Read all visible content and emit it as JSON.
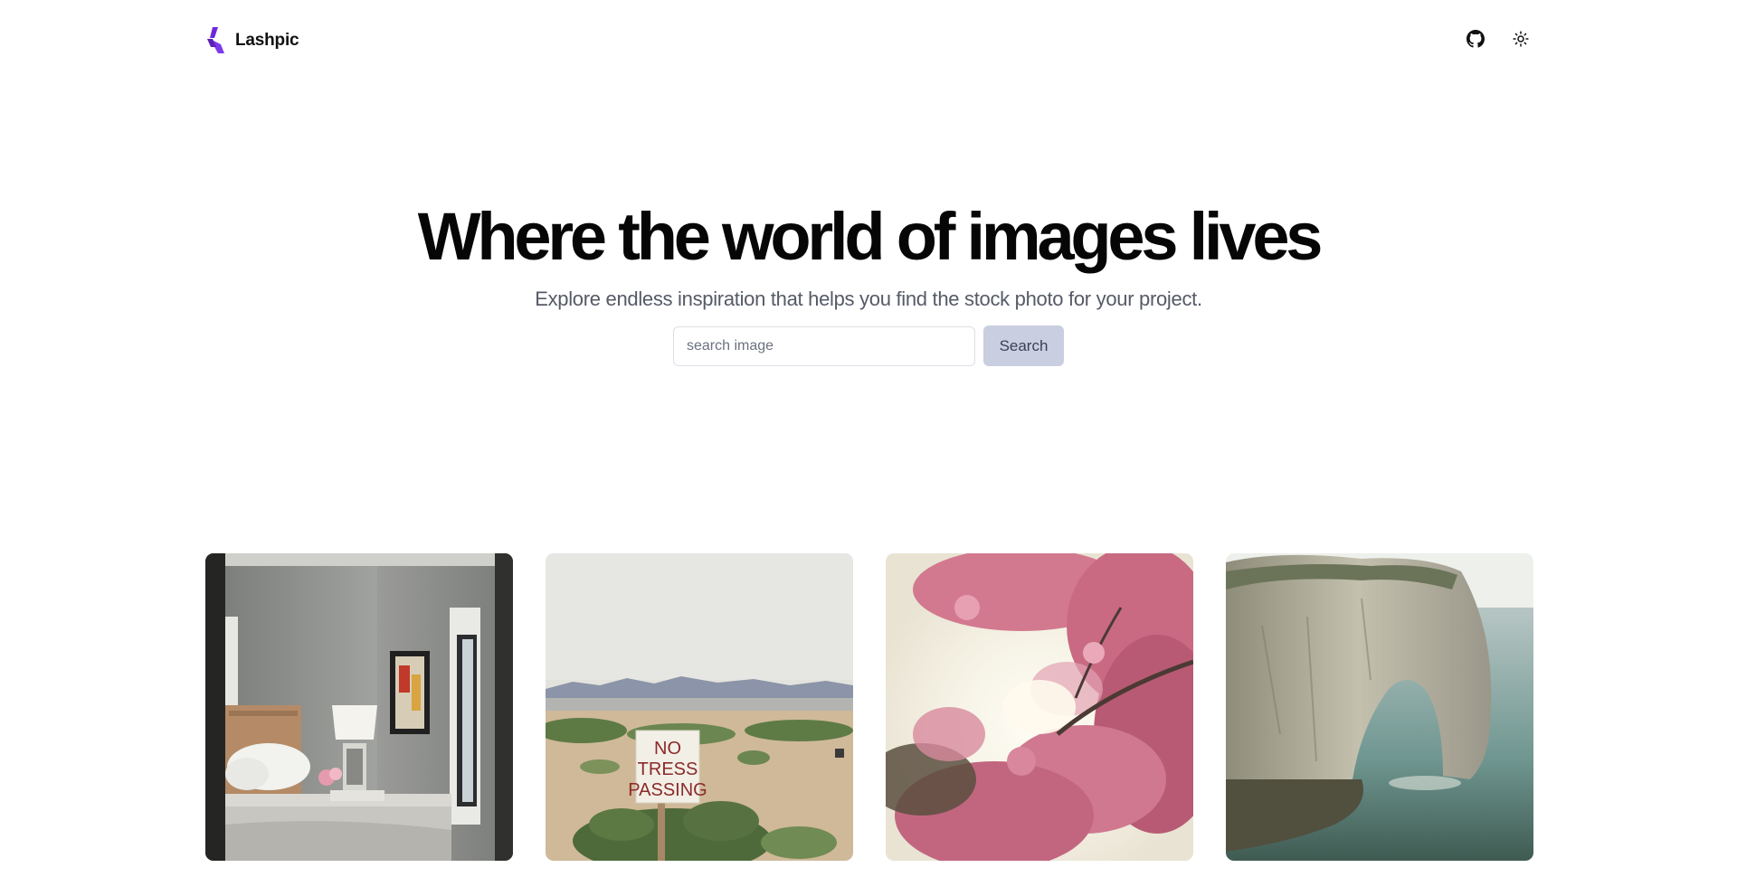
{
  "header": {
    "brand": "Lashpic",
    "brand_color": "#6d28d9",
    "actions": [
      {
        "icon": "github-icon"
      },
      {
        "icon": "sun-icon"
      }
    ]
  },
  "hero": {
    "title": "Where the world of images lives",
    "subtitle": "Explore endless inspiration that helps you find the stock photo for your project."
  },
  "search": {
    "placeholder": "search image",
    "value": "",
    "button_label": "Search"
  },
  "gallery": {
    "photos": [
      {
        "subject": "bedroom"
      },
      {
        "subject": "desert-sign",
        "sign_lines": [
          "NO",
          "TRESS",
          "PASSING"
        ]
      },
      {
        "subject": "cherry-blossoms"
      },
      {
        "subject": "sea-cliff-arch"
      }
    ]
  }
}
